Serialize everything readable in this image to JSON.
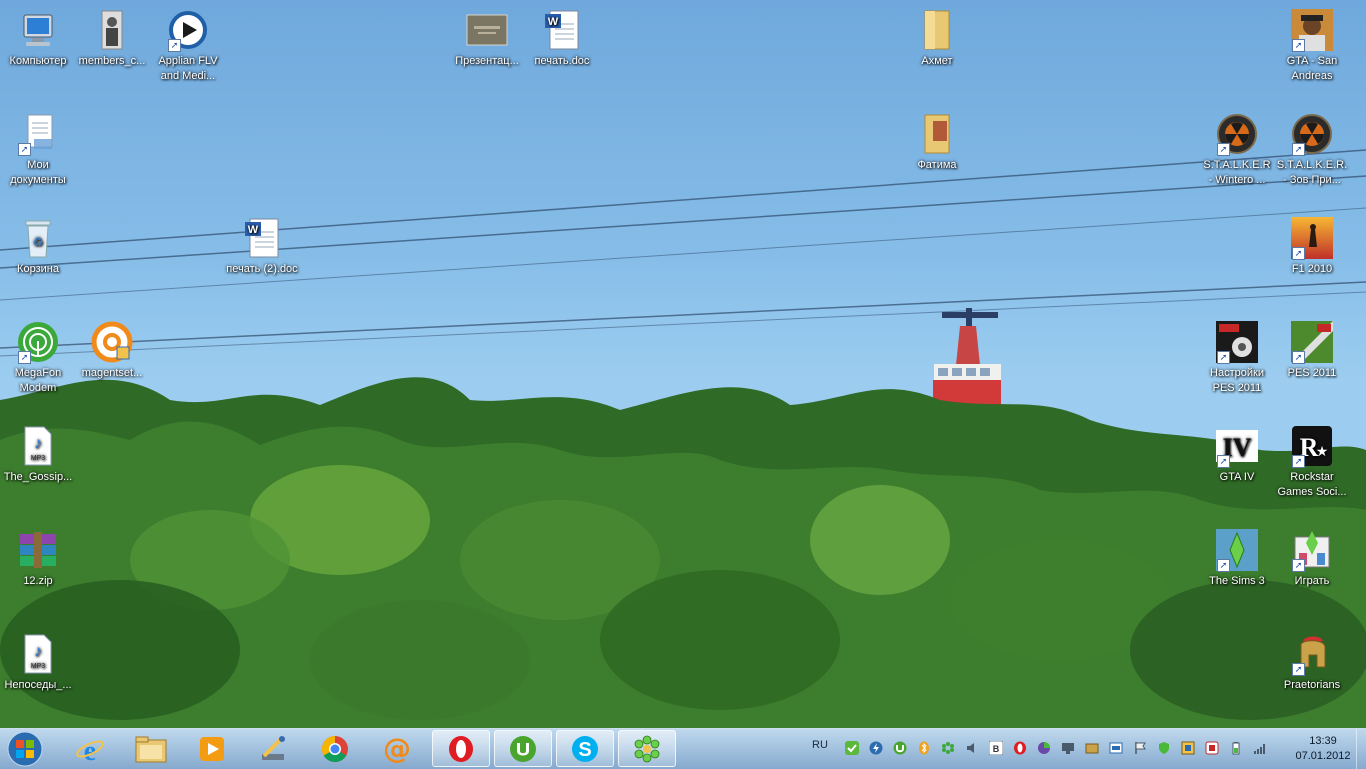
{
  "desktop": {
    "icons": [
      {
        "label": "Компьютер",
        "icon": "computer-icon",
        "shortcut": false
      },
      {
        "label": "members_c...",
        "icon": "photo-icon",
        "shortcut": false
      },
      {
        "label": "Applian FLV and Medi...",
        "icon": "media-player-icon",
        "shortcut": true
      },
      {
        "label": "Презентац...",
        "icon": "presentation-icon",
        "shortcut": false
      },
      {
        "label": "печать.doc",
        "icon": "word-doc-icon",
        "shortcut": false
      },
      {
        "label": "Ахмет",
        "icon": "folder-icon",
        "shortcut": false
      },
      {
        "label": "GTA - San Andreas",
        "icon": "gta-sa-icon",
        "shortcut": true
      },
      {
        "label": "Мои документы",
        "icon": "my-documents-icon",
        "shortcut": true
      },
      {
        "label": "Фатима",
        "icon": "folder-icon",
        "shortcut": false
      },
      {
        "label": "S.T.A.L.K.E.R - Wintero ...",
        "icon": "stalker-icon",
        "shortcut": true
      },
      {
        "label": "S.T.A.L.K.E.R. - Зов При...",
        "icon": "stalker-icon",
        "shortcut": true
      },
      {
        "label": "Корзина",
        "icon": "recycle-bin-icon",
        "shortcut": false
      },
      {
        "label": "печать (2).doc",
        "icon": "word-doc-icon",
        "shortcut": false
      },
      {
        "label": "F1 2010",
        "icon": "f1-icon",
        "shortcut": true
      },
      {
        "label": "MegaFon Modem",
        "icon": "megafon-icon",
        "shortcut": true
      },
      {
        "label": "magentset...",
        "icon": "magent-icon",
        "shortcut": false
      },
      {
        "label": "Настройки PES 2011",
        "icon": "pes-settings-icon",
        "shortcut": true
      },
      {
        "label": "PES 2011",
        "icon": "pes-icon",
        "shortcut": true
      },
      {
        "label": "The_Gossip...",
        "icon": "mp3-icon",
        "shortcut": false
      },
      {
        "label": "GTA IV",
        "icon": "gta-iv-icon",
        "shortcut": true
      },
      {
        "label": "Rockstar Games Soci...",
        "icon": "rockstar-icon",
        "shortcut": true
      },
      {
        "label": "12.zip",
        "icon": "winrar-icon",
        "shortcut": false
      },
      {
        "label": "The Sims 3",
        "icon": "sims-icon",
        "shortcut": true
      },
      {
        "label": "Играть",
        "icon": "play-game-icon",
        "shortcut": true
      },
      {
        "label": "Непоседы_...",
        "icon": "mp3-icon",
        "shortcut": false
      },
      {
        "label": "Praetorians",
        "icon": "praetorians-icon",
        "shortcut": true
      }
    ]
  },
  "taskbar": {
    "apps": [
      {
        "name": "internet-explorer",
        "active": false
      },
      {
        "name": "file-explorer",
        "active": false
      },
      {
        "name": "media-player",
        "active": false
      },
      {
        "name": "tool",
        "active": false
      },
      {
        "name": "chrome",
        "active": false
      },
      {
        "name": "mail-agent",
        "active": false
      },
      {
        "name": "opera",
        "active": true
      },
      {
        "name": "utorrent",
        "active": true
      },
      {
        "name": "skype",
        "active": true
      },
      {
        "name": "icq",
        "active": true
      }
    ],
    "language": "RU",
    "clock": {
      "time": "13:39",
      "date": "07.01.2012"
    }
  }
}
